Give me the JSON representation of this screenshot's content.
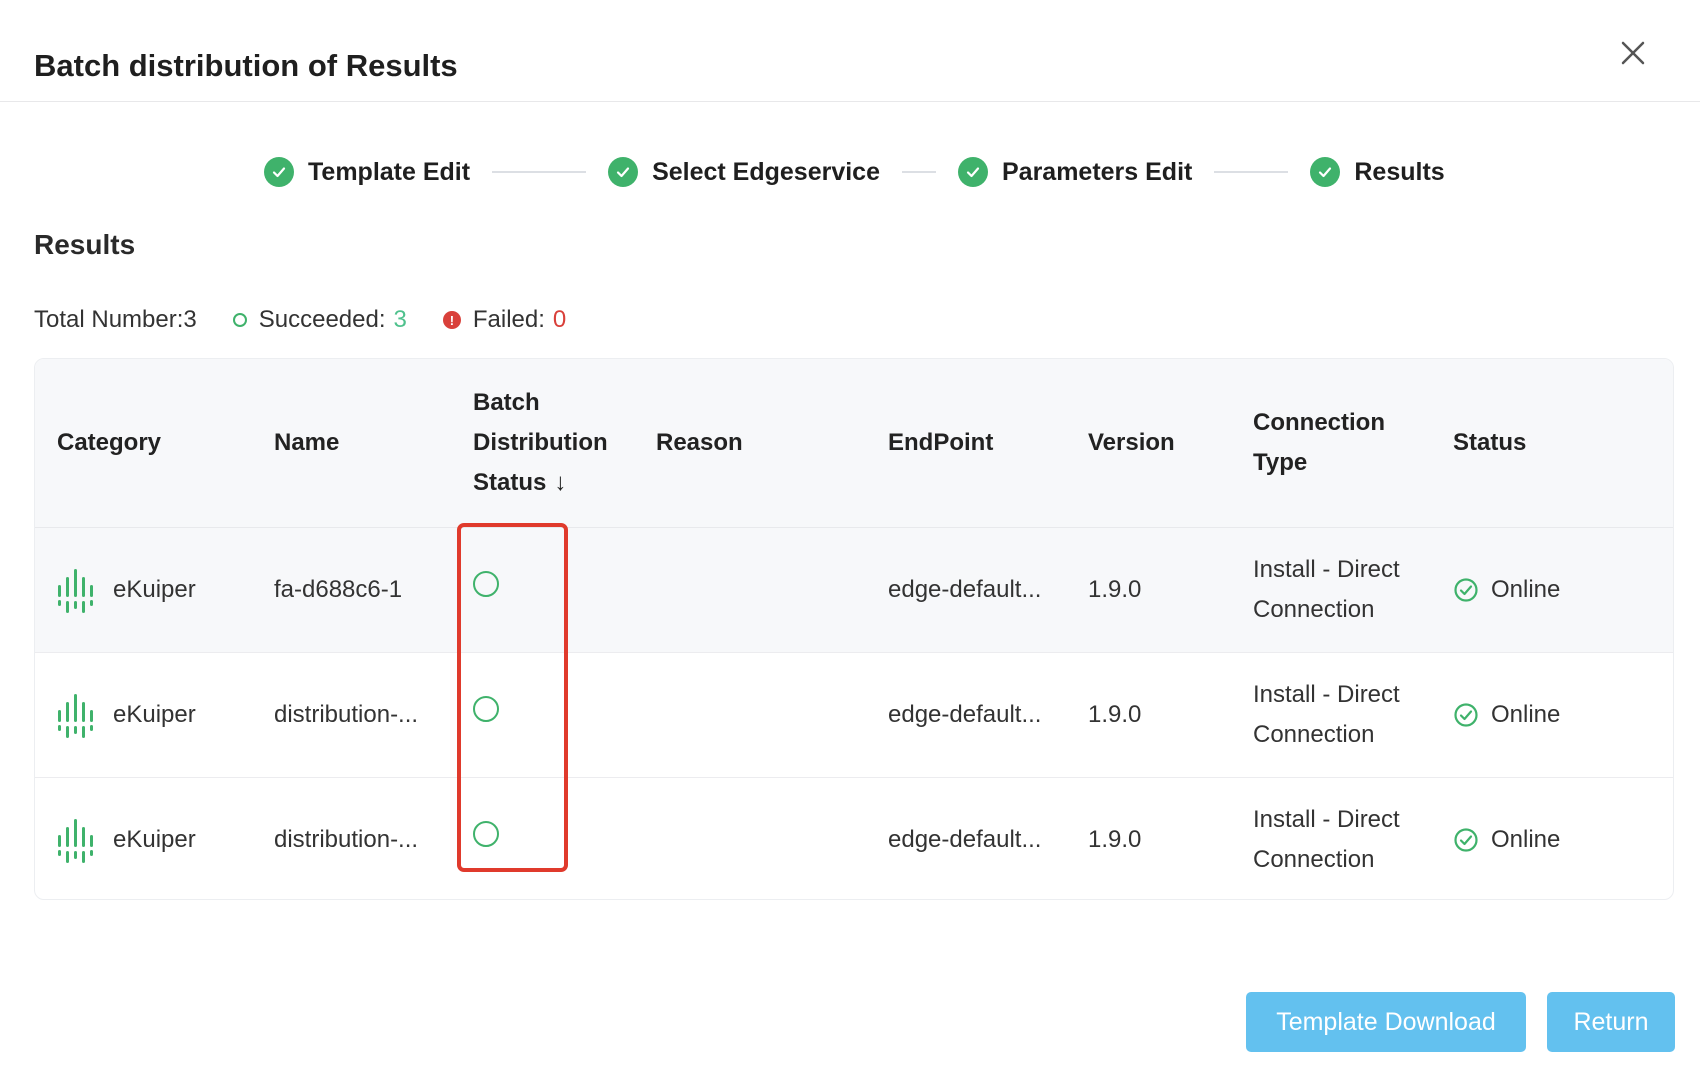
{
  "dialog": {
    "title": "Batch distribution of Results"
  },
  "steps": [
    {
      "label": "Template Edit",
      "status": "done"
    },
    {
      "label": "Select Edgeservice",
      "status": "done"
    },
    {
      "label": "Parameters Edit",
      "status": "done"
    },
    {
      "label": "Results",
      "status": "done"
    }
  ],
  "results": {
    "section_title": "Results",
    "total_label": "Total Number:3",
    "succeeded_label": "Succeeded:",
    "succeeded_value": "3",
    "failed_label": "Failed:",
    "failed_value": "0"
  },
  "table": {
    "columns": {
      "category": "Category",
      "name": "Name",
      "batch_status_line1": "Batch",
      "batch_status_line2": "Distribution",
      "batch_status_line3": "Status",
      "reason": "Reason",
      "endpoint": "EndPoint",
      "version": "Version",
      "connection_type_line1": "Connection",
      "connection_type_line2": "Type",
      "status": "Status"
    },
    "rows": [
      {
        "category": "eKuiper",
        "name": "fa-d688c6-1",
        "batch_status": "succeeded",
        "reason": "",
        "endpoint": "edge-default...",
        "version": "1.9.0",
        "connection_type_line1": "Install - Direct",
        "connection_type_line2": "Connection",
        "status": "Online"
      },
      {
        "category": "eKuiper",
        "name": "distribution-...",
        "batch_status": "succeeded",
        "reason": "",
        "endpoint": "edge-default...",
        "version": "1.9.0",
        "connection_type_line1": "Install - Direct",
        "connection_type_line2": "Connection",
        "status": "Online"
      },
      {
        "category": "eKuiper",
        "name": "distribution-...",
        "batch_status": "succeeded",
        "reason": "",
        "endpoint": "edge-default...",
        "version": "1.9.0",
        "connection_type_line1": "Install - Direct",
        "connection_type_line2": "Connection",
        "status": "Online"
      }
    ]
  },
  "footer": {
    "template_download": "Template Download",
    "return": "Return"
  },
  "colors": {
    "success": "#3fb26b",
    "success_text": "#4fc18d",
    "danger": "#d9403a",
    "primary_button": "#63c1ef",
    "highlight_box": "#e03a2c"
  },
  "icons": {
    "close": "close-icon",
    "step_done": "check-circle-icon",
    "category": "ekuiper-logo-icon",
    "online": "check-circle-outline-icon",
    "sort": "sort-down-icon"
  }
}
